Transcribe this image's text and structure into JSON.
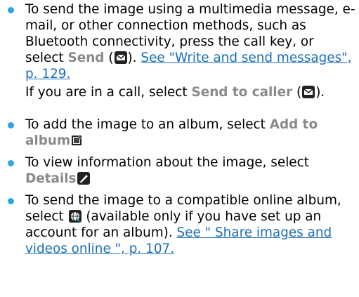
{
  "items": [
    {
      "text_pre": "To send the image using a multimedia message, e-mail, or other connection methods, such as Bluetooth connectivity, press the call key, or select ",
      "action": "Send",
      "paren_open": " (",
      "paren_close": ").",
      "link": "See \"Write and send messages\", p. 129.",
      "icon": "envelope-icon"
    },
    {
      "subtext_pre": "If you are in a call, select ",
      "action": "Send to caller",
      "paren_open": " (",
      "paren_close": ").",
      "icon": "envelope-icon"
    },
    {
      "text_pre": "To add the image to an album, select ",
      "action": "Add to album",
      "icon": "album-add-icon"
    },
    {
      "text_pre": "To view information about the image, select ",
      "action": "Details",
      "icon": "details-pencil-icon"
    },
    {
      "text_pre": "To send the image to a compatible online album, select ",
      "text_post": " (available only if you have set up an account for an album). ",
      "link": "See \" Share images and videos online \", p. 107.",
      "icon": "globe-share-icon"
    }
  ],
  "colors": {
    "bullet": "#2ea7e0",
    "action": "#8a8a8a",
    "link": "#1b6fb8"
  }
}
